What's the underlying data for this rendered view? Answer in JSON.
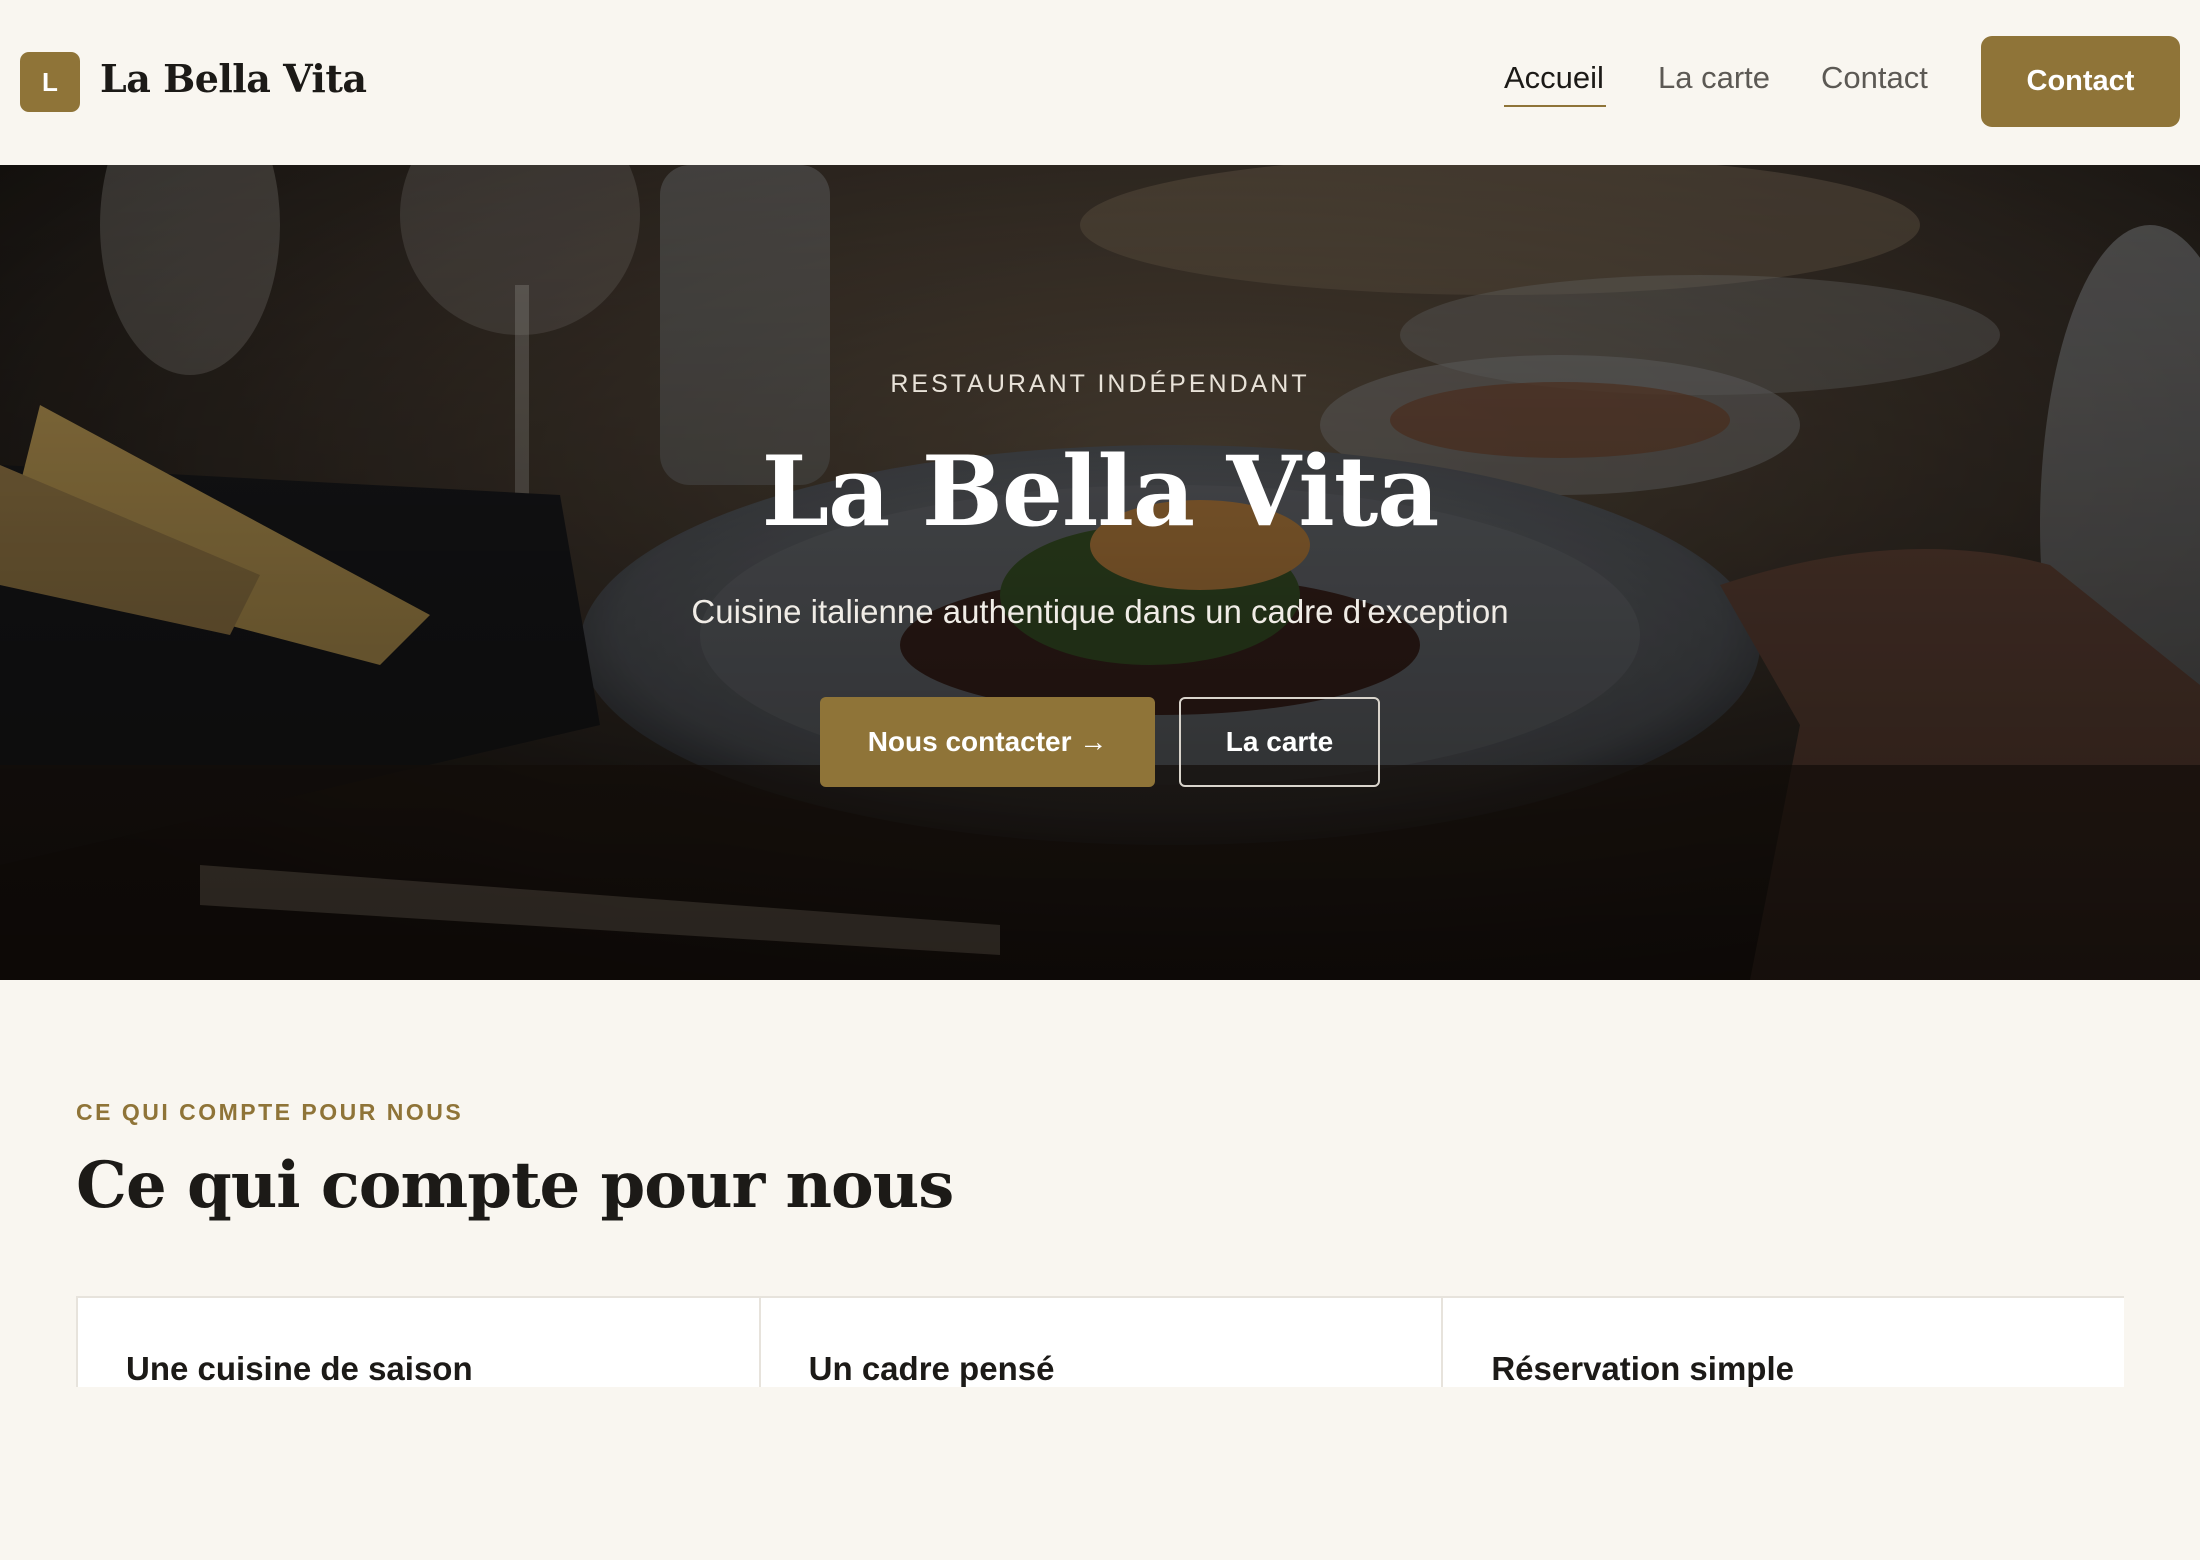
{
  "header": {
    "logo_letter": "L",
    "logo_text": "La Bella Vita",
    "nav": [
      {
        "label": "Accueil",
        "active": true
      },
      {
        "label": "La carte",
        "active": false
      },
      {
        "label": "Contact",
        "active": false
      }
    ],
    "cta_label": "Contact"
  },
  "hero": {
    "eyebrow": "RESTAURANT INDÉPENDANT",
    "title": "La Bella Vita",
    "subtitle": "Cuisine italienne authentique dans un cadre d'exception",
    "primary_button": "Nous contacter →",
    "secondary_button": "La carte",
    "background": "restaurant-table-photo"
  },
  "values": {
    "eyebrow": "CE QUI COMPTE POUR NOUS",
    "title": "Ce qui compte pour nous",
    "cards": [
      {
        "title": "Une cuisine de saison"
      },
      {
        "title": "Un cadre pensé"
      },
      {
        "title": "Réservation simple"
      }
    ]
  },
  "colors": {
    "accent": "#8f7438",
    "page_background": "#f9f6f0",
    "text": "#1c1a17"
  }
}
